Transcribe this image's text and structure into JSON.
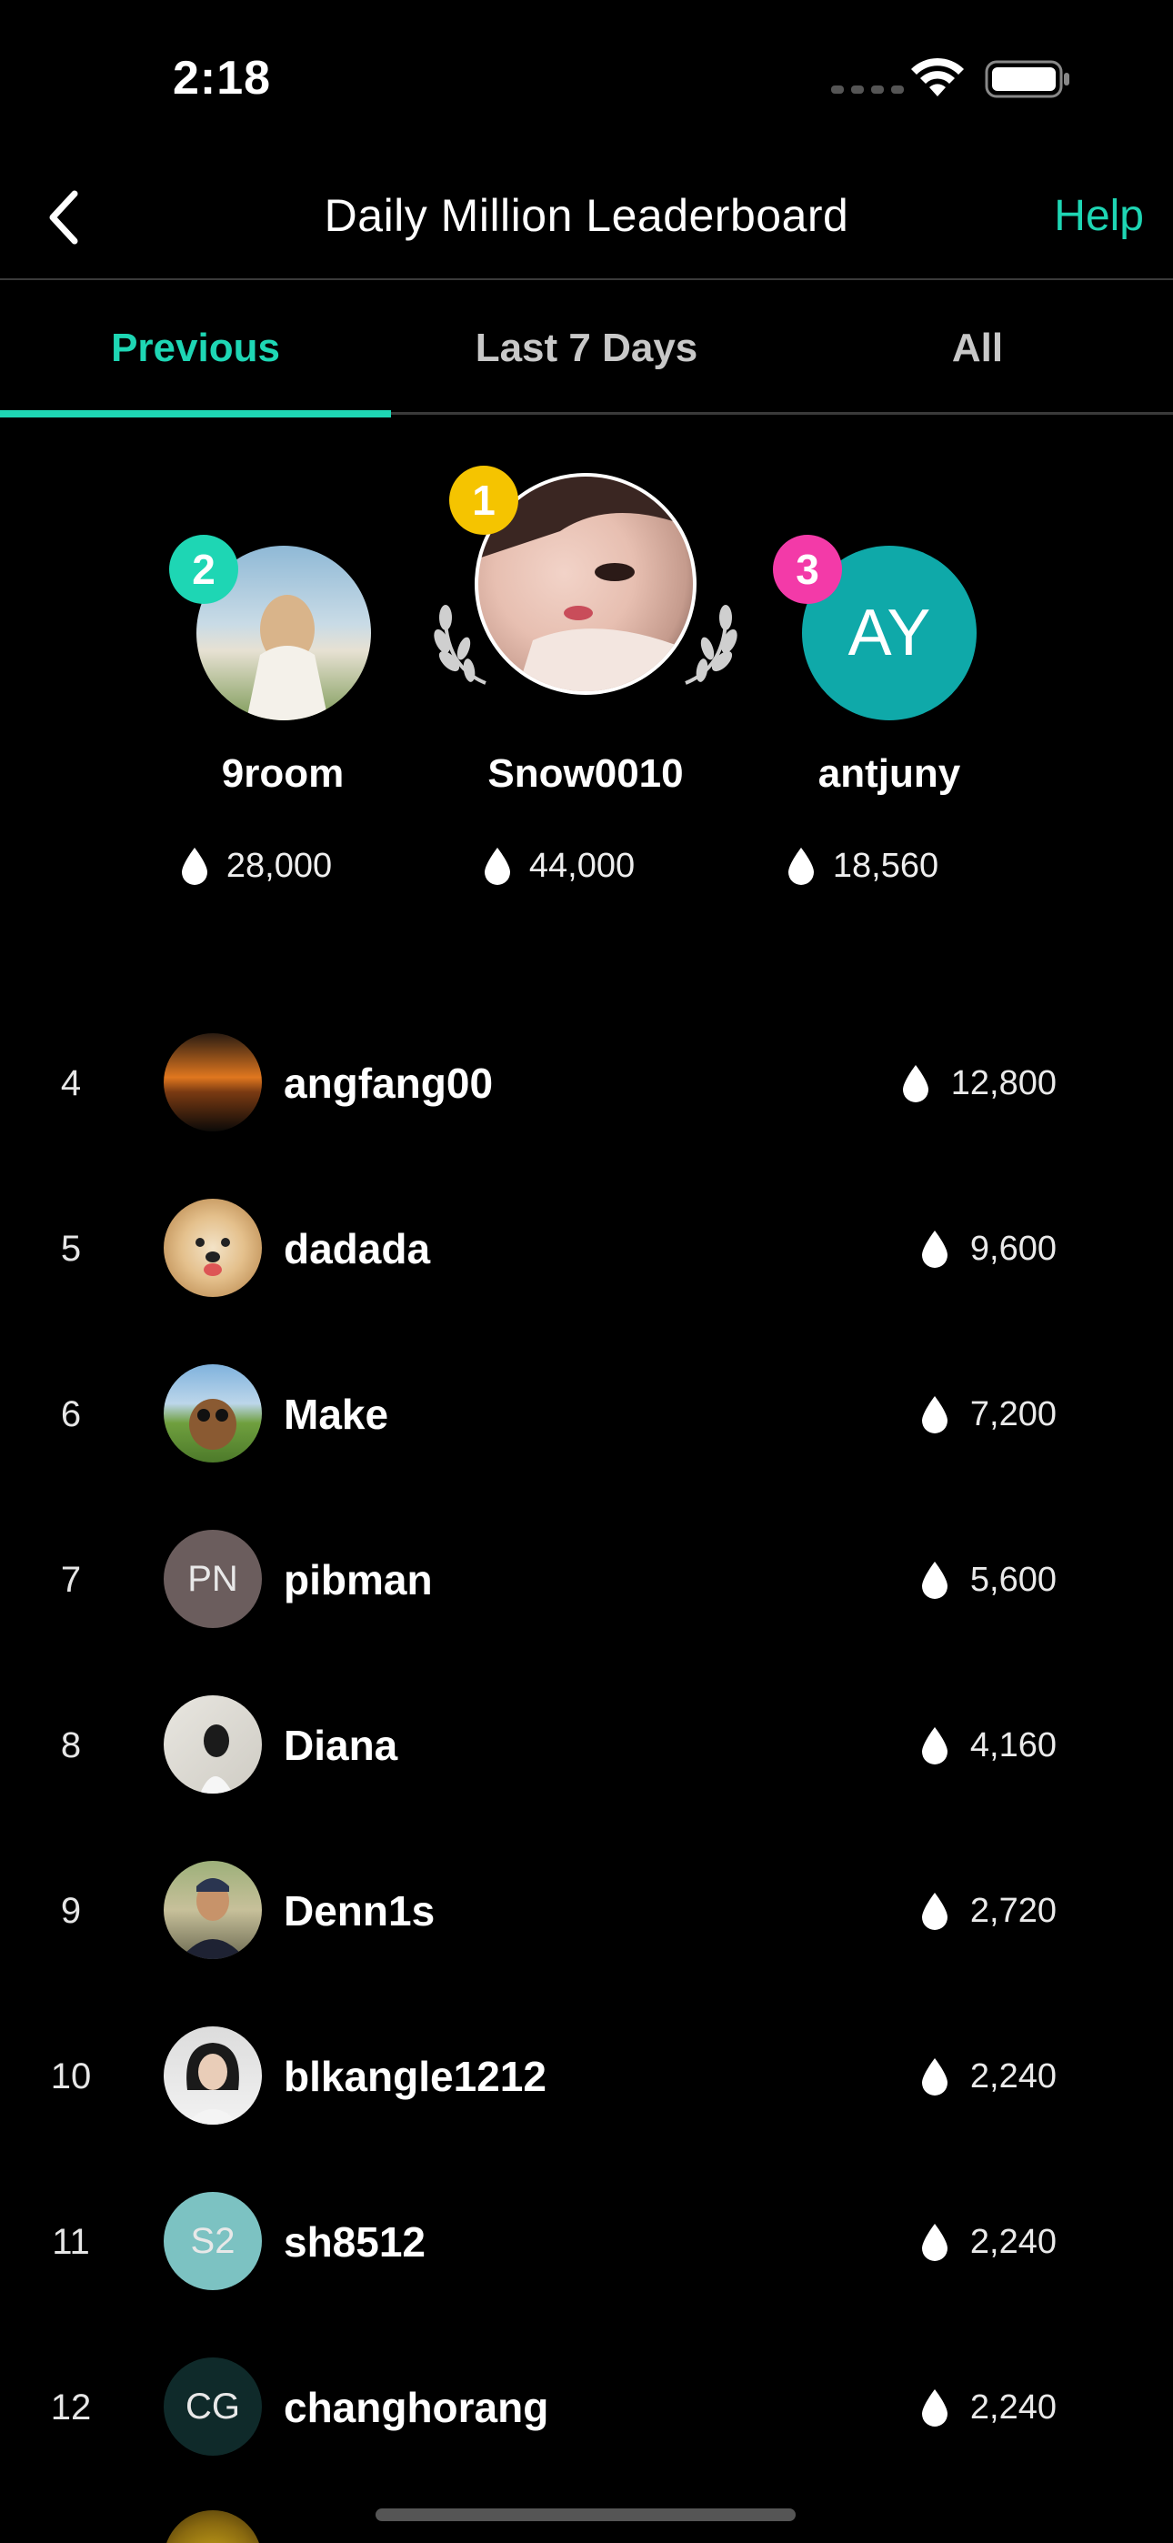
{
  "status_bar": {
    "time": "2:18"
  },
  "header": {
    "title": "Daily Million Leaderboard",
    "help_label": "Help",
    "back_icon": "chevron-left-icon"
  },
  "tabs": [
    {
      "label": "Previous",
      "active": true
    },
    {
      "label": "Last 7 Days",
      "active": false
    },
    {
      "label": "All",
      "active": false
    }
  ],
  "podium": {
    "first": {
      "rank": "1",
      "name": "Snow0010",
      "score": "44,000",
      "badge_color": "#f5c400"
    },
    "second": {
      "rank": "2",
      "name": "9room",
      "score": "28,000",
      "badge_color": "#1ed6b4"
    },
    "third": {
      "rank": "3",
      "name": "antjuny",
      "score": "18,560",
      "badge_color": "#f33aa8",
      "initials": "AY",
      "avatar_color": "#0fa9a9"
    }
  },
  "leaderboard": [
    {
      "rank": "4",
      "name": "angfang00",
      "score": "12,800"
    },
    {
      "rank": "5",
      "name": "dadada",
      "score": "9,600"
    },
    {
      "rank": "6",
      "name": "Make",
      "score": "7,200"
    },
    {
      "rank": "7",
      "name": "pibman",
      "score": "5,600",
      "initials": "PN",
      "avatar_color": "#6b5d5d"
    },
    {
      "rank": "8",
      "name": "Diana",
      "score": "4,160"
    },
    {
      "rank": "9",
      "name": "Denn1s",
      "score": "2,720"
    },
    {
      "rank": "10",
      "name": "blkangle1212",
      "score": "2,240"
    },
    {
      "rank": "11",
      "name": "sh8512",
      "score": "2,240",
      "initials": "S2",
      "avatar_color": "#7cc2c2"
    },
    {
      "rank": "12",
      "name": "changhorang",
      "score": "2,240",
      "initials": "CG",
      "avatar_color": "#0f2a2a"
    }
  ],
  "colors": {
    "accent": "#1ed6b4",
    "background": "#000000"
  }
}
